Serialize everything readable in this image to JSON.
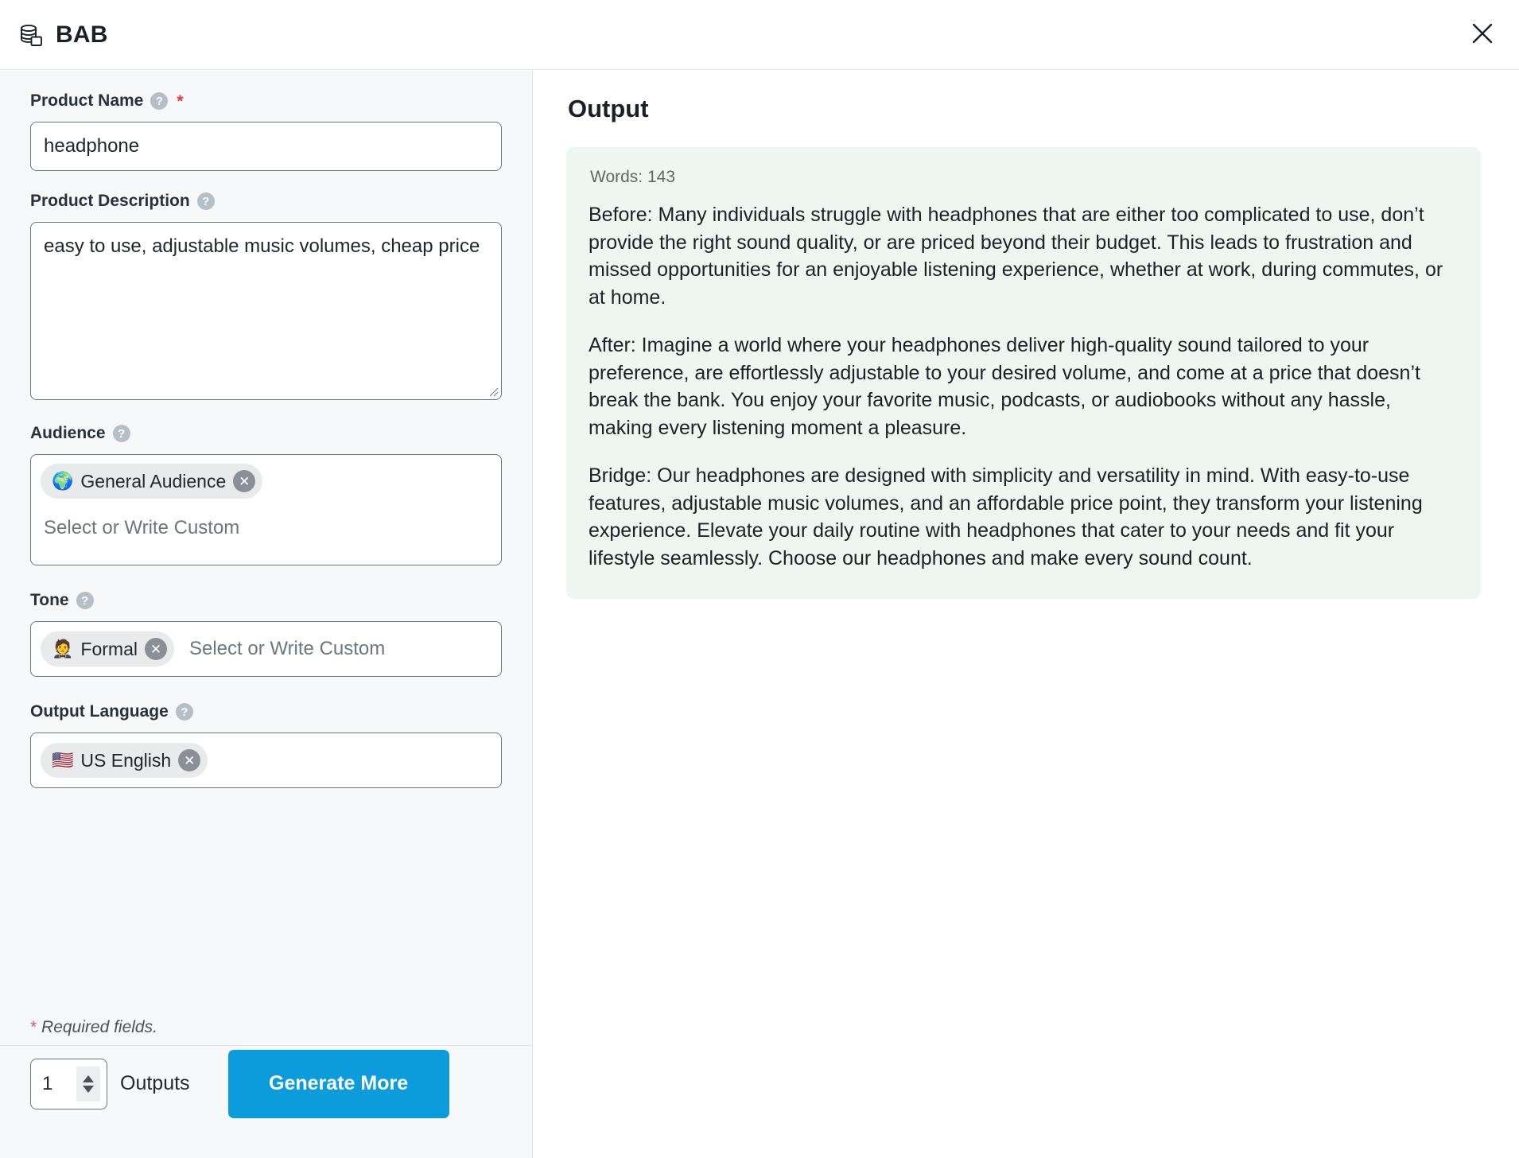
{
  "header": {
    "title": "BAB",
    "app_icon": "database-stack-icon",
    "close_icon": "close-icon"
  },
  "form": {
    "product_name": {
      "label": "Product Name",
      "help_icon": "help-circle-icon",
      "required_marker": "*",
      "value": "headphone"
    },
    "product_description": {
      "label": "Product Description",
      "help_icon": "help-circle-icon",
      "value": "easy to use, adjustable music volumes, cheap price"
    },
    "audience": {
      "label": "Audience",
      "help_icon": "help-circle-icon",
      "placeholder": "Select or Write Custom",
      "tags": [
        {
          "emoji": "🌍",
          "label": "General Audience",
          "remove_icon": "close-circle-icon"
        }
      ]
    },
    "tone": {
      "label": "Tone",
      "help_icon": "help-circle-icon",
      "placeholder": "Select or Write Custom",
      "tags": [
        {
          "emoji": "🤵",
          "label": "Formal",
          "remove_icon": "close-circle-icon"
        }
      ]
    },
    "output_language": {
      "label": "Output Language",
      "help_icon": "help-circle-icon",
      "tags": [
        {
          "emoji": "🇺🇸",
          "label": "US English",
          "remove_icon": "close-circle-icon"
        }
      ]
    },
    "required_note_star": "*",
    "required_note": "Required fields."
  },
  "footer": {
    "outputs_count": "1",
    "outputs_label": "Outputs",
    "generate_label": "Generate More",
    "spinner_up_icon": "chevron-up-icon",
    "spinner_down_icon": "chevron-down-icon",
    "accent_color": "#0d9cdb"
  },
  "output": {
    "title": "Output",
    "words_label": "Words: 143",
    "card_color": "#eef6f1",
    "paragraphs": [
      "Before: Many individuals struggle with headphones that are either too complicated to use, don’t provide the right sound quality, or are priced beyond their budget. This leads to frustration and missed opportunities for an enjoyable listening experience, whether at work, during commutes, or at home.",
      "After: Imagine a world where your headphones deliver high-quality sound tailored to your preference, are effortlessly adjustable to your desired volume, and come at a price that doesn’t break the bank. You enjoy your favorite music, podcasts, or audiobooks without any hassle, making every listening moment a pleasure.",
      "Bridge: Our headphones are designed with simplicity and versatility in mind. With easy-to-use features, adjustable music volumes, and an affordable price point, they transform your listening experience. Elevate your daily routine with headphones that cater to your needs and fit your lifestyle seamlessly. Choose our headphones and make every sound count."
    ]
  }
}
